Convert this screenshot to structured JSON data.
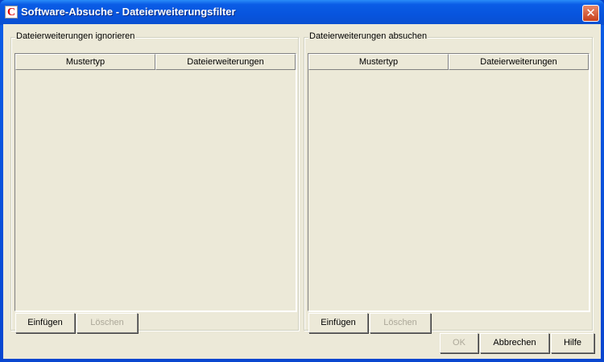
{
  "window": {
    "title": "Software-Absuche - Dateierweiterungsfilter",
    "close_label": "✕"
  },
  "left_panel": {
    "legend": "Dateierweiterungen ignorieren",
    "columns": [
      "Mustertyp",
      "Dateierweiterungen"
    ],
    "rows": [],
    "insert_label": "Einfügen",
    "delete_label": "Löschen"
  },
  "right_panel": {
    "legend": "Dateierweiterungen absuchen",
    "columns": [
      "Mustertyp",
      "Dateierweiterungen"
    ],
    "rows": [],
    "insert_label": "Einfügen",
    "delete_label": "Löschen"
  },
  "footer": {
    "ok_label": "OK",
    "cancel_label": "Abbrechen",
    "help_label": "Hilfe"
  }
}
